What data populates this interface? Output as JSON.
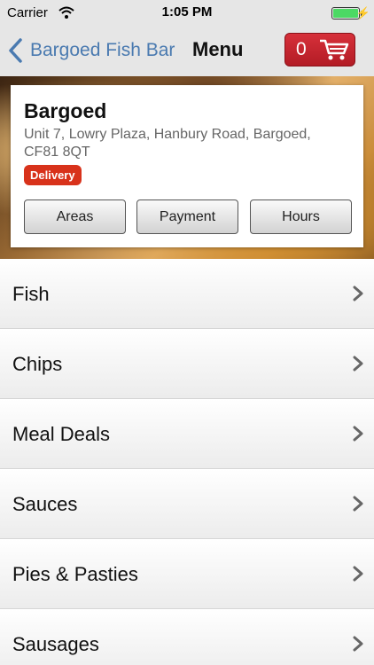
{
  "status_bar": {
    "carrier": "Carrier",
    "time": "1:05 PM"
  },
  "nav": {
    "back_label": "Bargoed Fish Bar",
    "title": "Menu",
    "cart_count": "0"
  },
  "shop": {
    "name": "Bargoed",
    "address": "Unit 7, Lowry Plaza, Hanbury Road, Bargoed, CF81 8QT",
    "badge": "Delivery",
    "buttons": {
      "areas": "Areas",
      "payment": "Payment",
      "hours": "Hours"
    }
  },
  "menu": {
    "items": [
      {
        "label": "Fish"
      },
      {
        "label": "Chips"
      },
      {
        "label": "Meal Deals"
      },
      {
        "label": "Sauces"
      },
      {
        "label": "Pies & Pasties"
      },
      {
        "label": "Sausages"
      }
    ]
  },
  "colors": {
    "accent": "#4a7ab0",
    "cart": "#c4262f",
    "badge": "#d8321b",
    "battery": "#4cd964"
  }
}
